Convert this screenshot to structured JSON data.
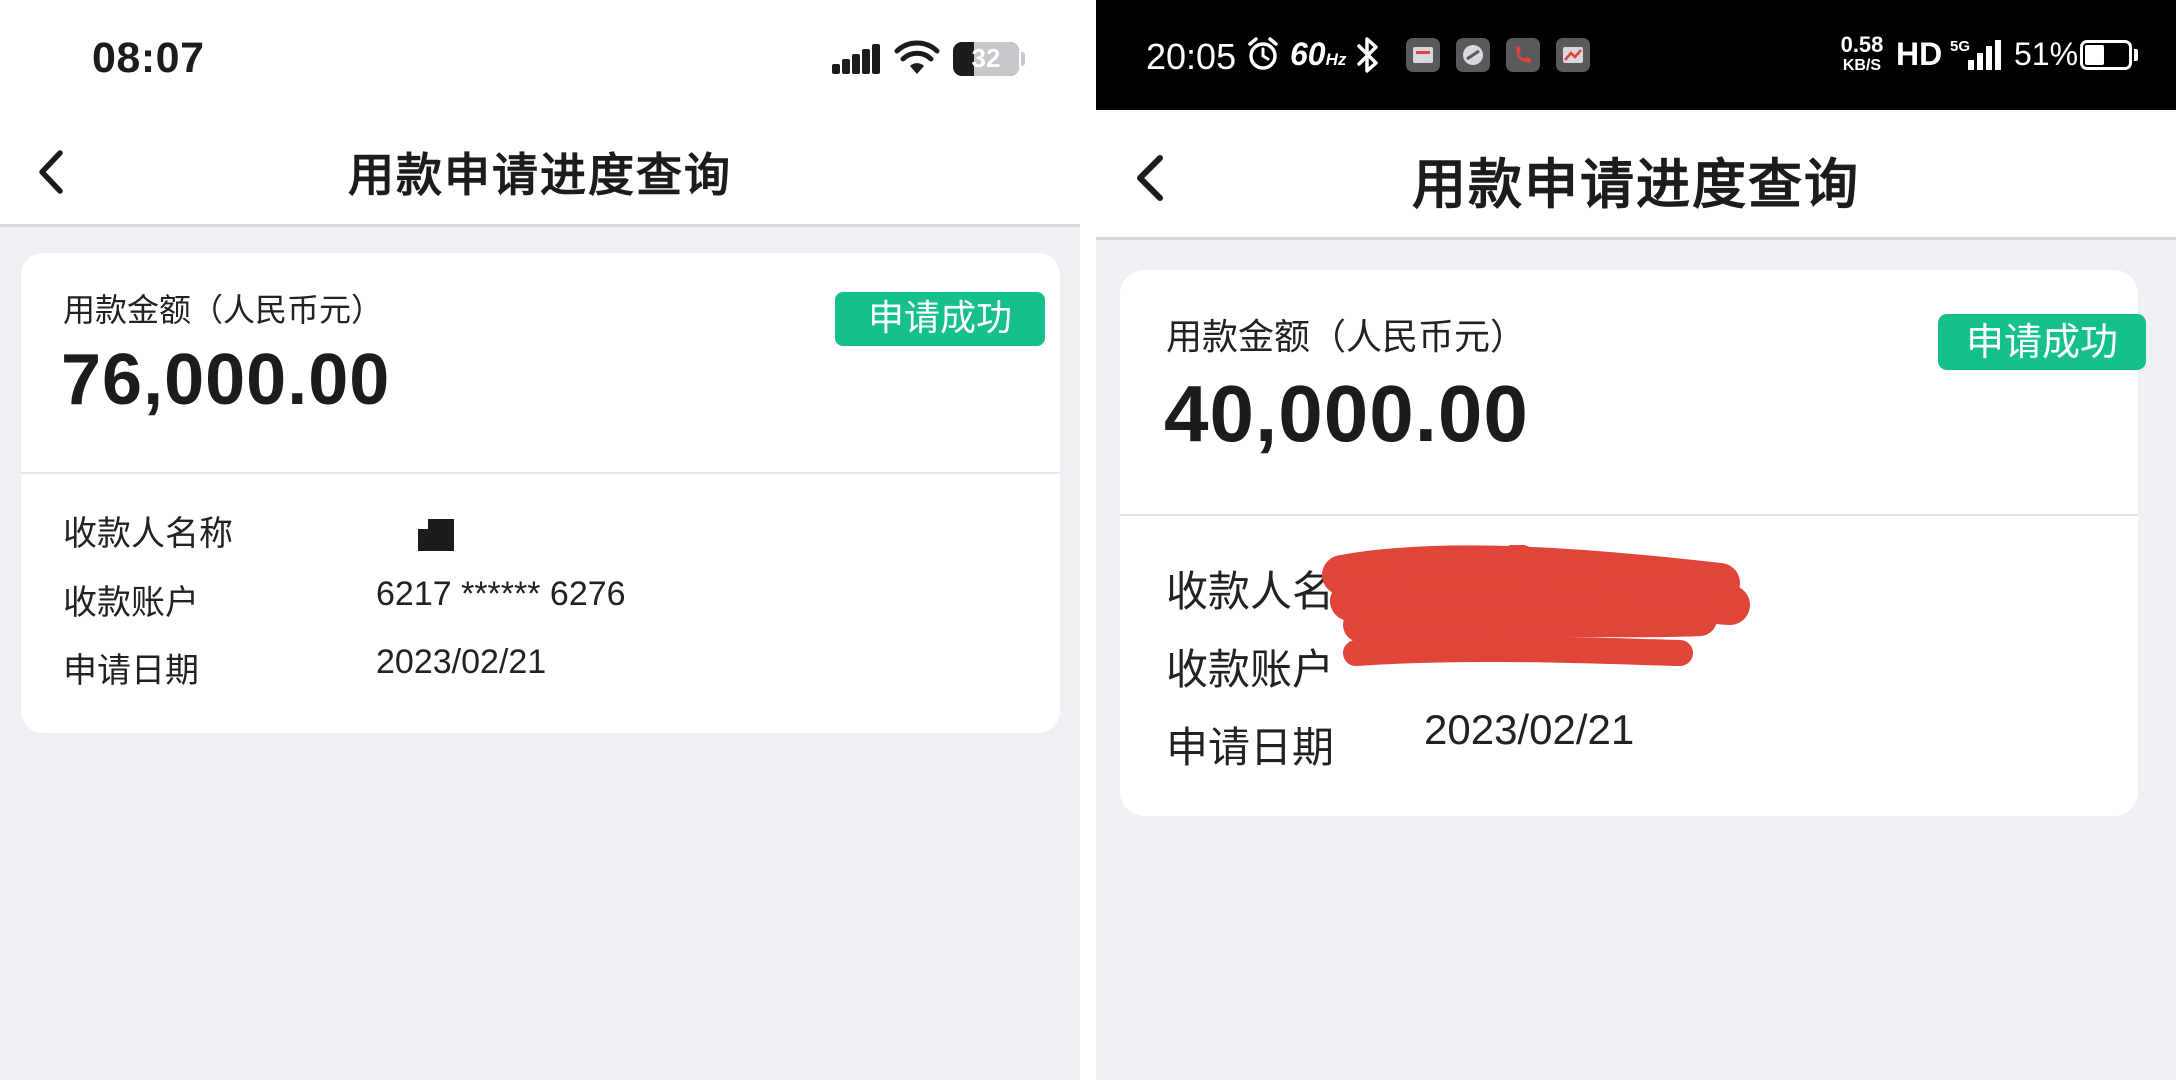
{
  "left_screen": {
    "status_bar": {
      "time": "08:07",
      "battery": "32",
      "battery_fraction": 0.32,
      "icons": [
        "cellular-signal-icon",
        "wifi-icon",
        "battery-icon"
      ]
    },
    "nav": {
      "back_icon": "chevron-left-icon",
      "title": "用款申请进度查询"
    },
    "summary": {
      "amount_label": "用款金额（人民币元）",
      "amount": "76,000.00",
      "status": "申请成功",
      "status_color": "#16c08c"
    },
    "details": [
      {
        "label": "收款人名称",
        "value": ""
      },
      {
        "label": "收款账户",
        "value": "6217 ****** 6276"
      },
      {
        "label": "申请日期",
        "value": "2023/02/21"
      }
    ]
  },
  "right_screen": {
    "status_bar": {
      "time": "20:05",
      "refresh_rate": "60",
      "refresh_unit": "Hz",
      "net_speed": "0.58",
      "net_speed_unit": "KB/S",
      "hd": "HD",
      "network": "5G",
      "battery": "51%",
      "battery_fraction": 0.51,
      "icons": [
        "alarm-icon",
        "bluetooth-icon",
        "app-notification-icon",
        "phone-icon",
        "cellular-signal-icon",
        "battery-icon"
      ]
    },
    "nav": {
      "back_icon": "chevron-left-icon",
      "title": "用款申请进度查询"
    },
    "summary": {
      "amount_label": "用款金额（人民币元）",
      "amount": "40,000.00",
      "status": "申请成功",
      "status_color": "#16c08c"
    },
    "details": [
      {
        "label": "收款人名称",
        "value": ""
      },
      {
        "label": "收款账户",
        "value": ""
      },
      {
        "label": "申请日期",
        "value": "2023/02/21"
      }
    ],
    "redaction_color": "#e0453a"
  }
}
